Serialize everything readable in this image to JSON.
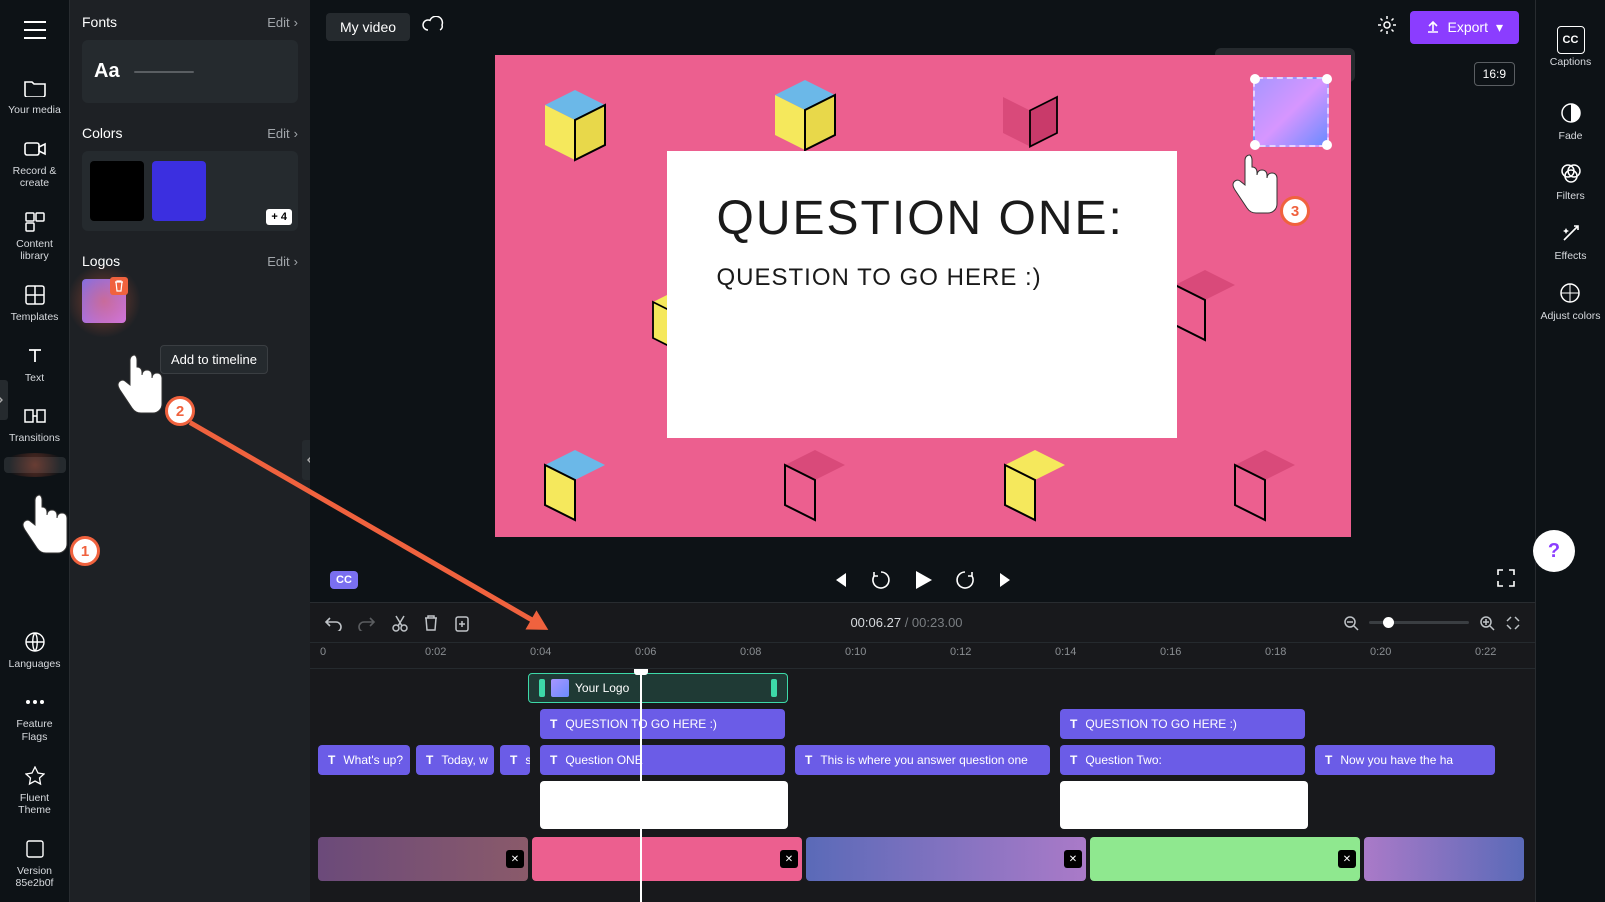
{
  "rail": {
    "items": [
      {
        "label": "Your media",
        "icon": "folder"
      },
      {
        "label": "Record & create",
        "icon": "camera"
      },
      {
        "label": "Content library",
        "icon": "library"
      },
      {
        "label": "Templates",
        "icon": "grid"
      },
      {
        "label": "Text",
        "icon": "text"
      },
      {
        "label": "Transitions",
        "icon": "transition"
      }
    ],
    "bottom": [
      {
        "label": "Languages",
        "icon": "globe"
      },
      {
        "label": "Feature Flags",
        "icon": "dots"
      },
      {
        "label": "Fluent Theme",
        "icon": "theme"
      },
      {
        "label": "Version 85e2b0f",
        "icon": "version"
      }
    ]
  },
  "sidepanel": {
    "fonts": {
      "title": "Fonts",
      "edit": "Edit",
      "aa": "Aa"
    },
    "colors": {
      "title": "Colors",
      "edit": "Edit",
      "more": "+ 4",
      "swatches": [
        "#3b2fe0"
      ]
    },
    "logos": {
      "title": "Logos",
      "edit": "Edit"
    },
    "tooltip": "Add to timeline"
  },
  "pointers": {
    "p1": "1",
    "p2": "2",
    "p3": "3"
  },
  "topbar": {
    "title": "My video",
    "export": "Export",
    "captions": "Captions"
  },
  "canvas": {
    "heading": "QUESTION ONE:",
    "sub": "QUESTION TO GO HERE :)",
    "aspect": "16:9"
  },
  "proprail": {
    "items": [
      {
        "label": "Fade"
      },
      {
        "label": "Filters"
      },
      {
        "label": "Effects"
      },
      {
        "label": "Adjust colors"
      }
    ]
  },
  "playback": {
    "cc": "CC"
  },
  "timeline": {
    "current": "00:06.27",
    "total": "00:23.00",
    "ticks": [
      "0",
      "0:02",
      "0:04",
      "0:06",
      "0:08",
      "0:10",
      "0:12",
      "0:14",
      "0:16",
      "0:18",
      "0:20",
      "0:22"
    ],
    "logo_clip": "Your Logo",
    "text_clips_row1": [
      "QUESTION TO GO HERE :)",
      "QUESTION TO GO HERE :)"
    ],
    "text_clips_row2": [
      "What's up?",
      "Today, w",
      "s",
      "Question ONE",
      "This is where you answer question one",
      "Question Two:",
      "Now you have the ha"
    ]
  }
}
